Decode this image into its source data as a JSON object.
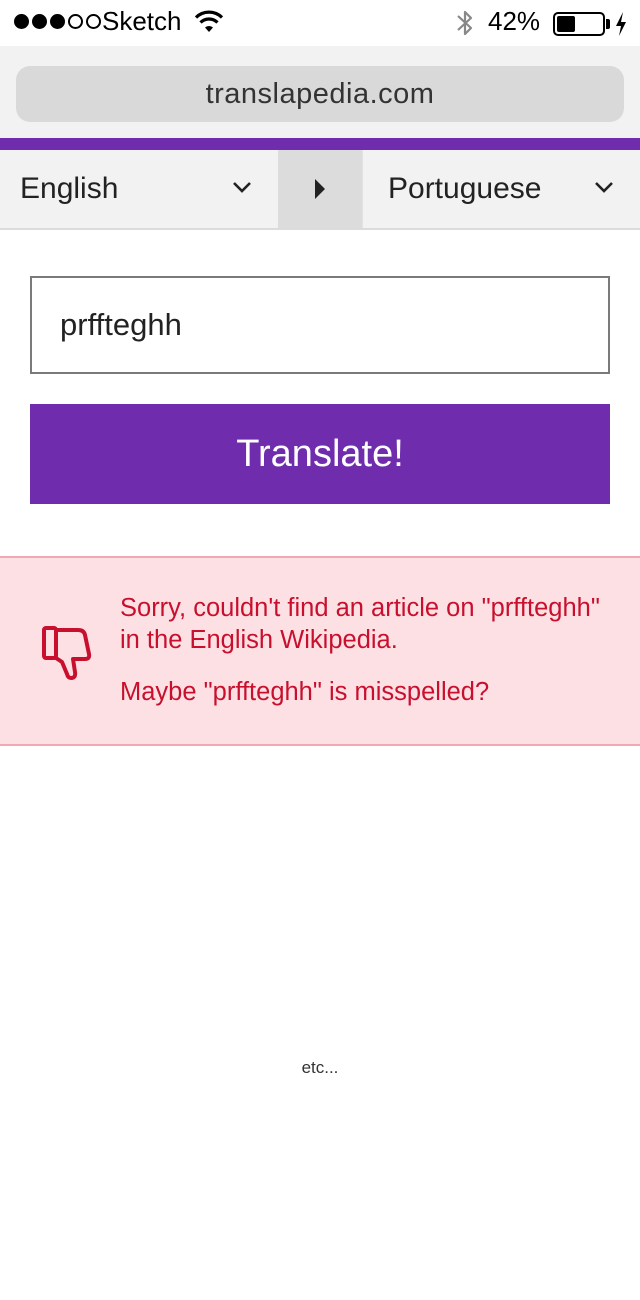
{
  "status_bar": {
    "carrier": "Sketch",
    "battery_percent": "42%",
    "battery_level": 0.42
  },
  "browser": {
    "url": "translapedia.com"
  },
  "colors": {
    "accent": "#6f2dad",
    "error_text": "#c8102e",
    "error_bg": "#fde0e4"
  },
  "language_selector": {
    "source_language": "English",
    "target_language": "Portuguese"
  },
  "search": {
    "value": "prffteghh"
  },
  "translate_button": {
    "label": "Translate!"
  },
  "alert": {
    "icon": "thumbs-down-icon",
    "message": "Sorry, couldn't find an article on \"prffteghh\" in the English Wikipedia.",
    "suggestion": "Maybe \"prffteghh\" is misspelled?"
  },
  "footer": {
    "text": "etc..."
  }
}
